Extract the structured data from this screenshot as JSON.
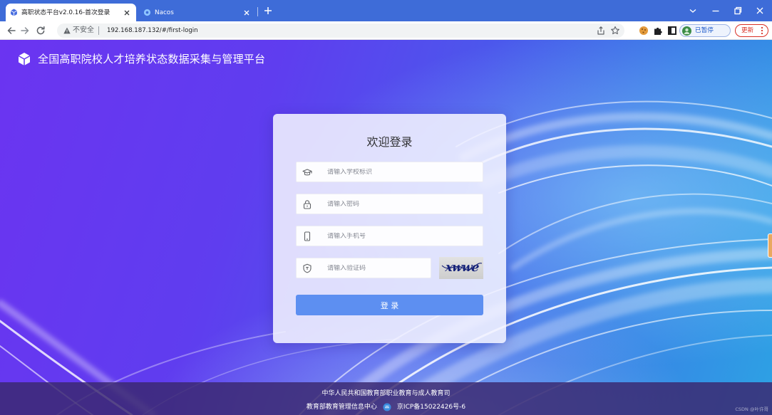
{
  "browser": {
    "tabs": [
      {
        "title": "高职状态平台v2.0.16-首次登录",
        "favicon": "cube-logo-icon",
        "close_icon": "close-icon"
      },
      {
        "title": "Nacos",
        "favicon": "nacos-icon",
        "close_icon": "close-icon"
      }
    ],
    "new_tab_icon": "plus-icon",
    "window_controls": [
      "chevron-down-icon",
      "minimize-icon",
      "restore-icon",
      "close-icon"
    ],
    "nav_icons": [
      "back-arrow-icon",
      "forward-arrow-icon",
      "reload-icon"
    ],
    "address_bar": {
      "security_icon": "warning-triangle-icon",
      "security_label": "不安全",
      "url": "192.168.187.132/#/first-login",
      "action_icons": [
        "share-icon",
        "bookmark-star-icon"
      ]
    },
    "extension_icons": [
      "cookie-extension-icon",
      "extensions-puzzle-icon",
      "side-panel-icon"
    ],
    "profile": {
      "avatar": "profile-avatar-icon",
      "status_label": "已暂停"
    },
    "update_button": {
      "label": "更新",
      "menu_icon": "kebab-menu-icon"
    }
  },
  "header": {
    "logo": "cube-logo-icon",
    "title": "全国高职院校人才培养状态数据采集与管理平台"
  },
  "login_form": {
    "title": "欢迎登录",
    "fields": [
      {
        "icon": "graduation-cap-icon",
        "placeholder": "请输入学校标识",
        "value": ""
      },
      {
        "icon": "lock-icon",
        "placeholder": "请输入密码",
        "value": ""
      },
      {
        "icon": "mobile-phone-icon",
        "placeholder": "请输入手机号",
        "value": ""
      },
      {
        "icon": "shield-icon",
        "placeholder": "请输入验证码",
        "value": ""
      }
    ],
    "captcha_text": "xwwe",
    "submit_label": "登 录"
  },
  "footer": {
    "line1": "中华人民共和国教育部职业教育与成人教育司",
    "org": "教育部教育管理信息中心",
    "badge_icon": "record-badge-icon",
    "icp": "京ICP备15022426号-6",
    "watermark": "CSDN @叶许哥"
  },
  "theme": {
    "tab_strip": "#3e6cd8",
    "primary_button": "#5d8ff1"
  }
}
